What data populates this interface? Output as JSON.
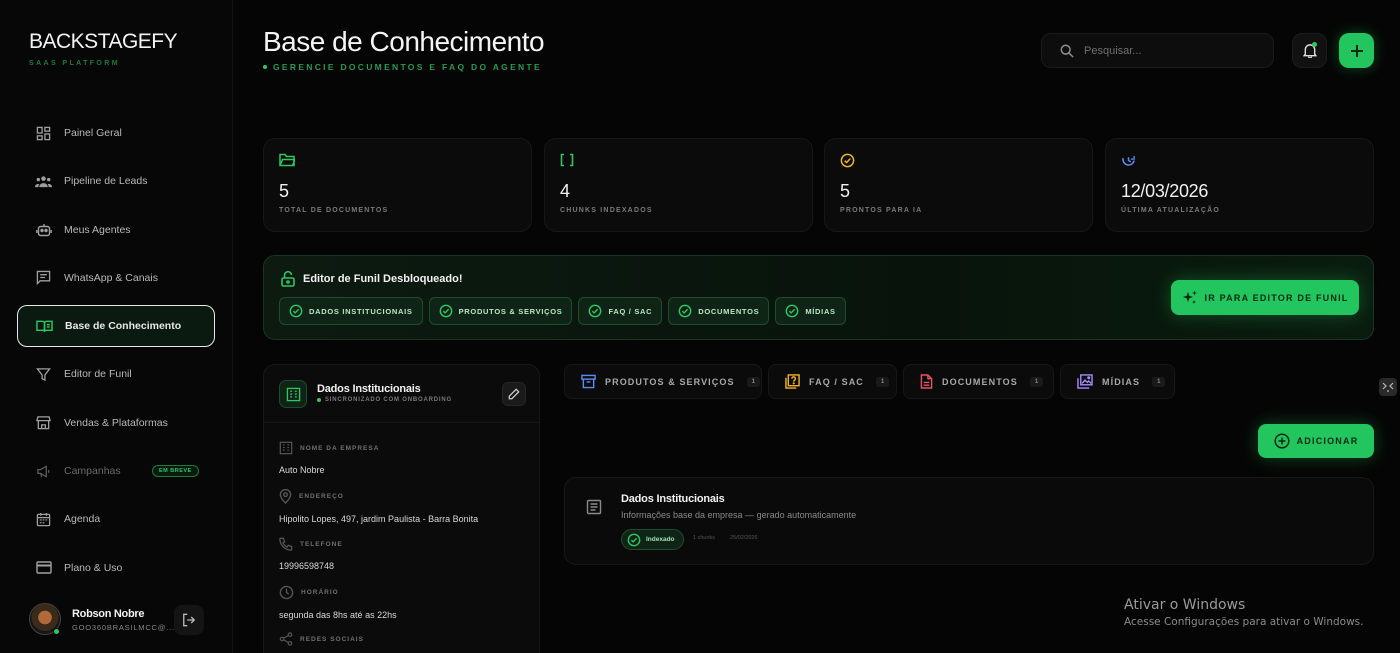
{
  "brand": {
    "name": "BACKSTAGEFY",
    "tagline": "SAAS PLATFORM"
  },
  "sidebar": {
    "items": [
      {
        "label": "Painel Geral",
        "icon": "dashboard-icon"
      },
      {
        "label": "Pipeline de Leads",
        "icon": "users-icon"
      },
      {
        "label": "Meus Agentes",
        "icon": "robot-icon"
      },
      {
        "label": "WhatsApp & Canais",
        "icon": "chat-icon"
      },
      {
        "label": "Base de Conhecimento",
        "icon": "book-icon",
        "active": true
      },
      {
        "label": "Editor de Funil",
        "icon": "funnel-icon"
      },
      {
        "label": "Vendas & Plataformas",
        "icon": "store-icon"
      },
      {
        "label": "Campanhas",
        "icon": "megaphone-icon",
        "badge": "EM BREVE",
        "disabled": true
      },
      {
        "label": "Agenda",
        "icon": "calendar-icon"
      },
      {
        "label": "Plano & Uso",
        "icon": "credit-card-icon"
      }
    ]
  },
  "user": {
    "name": "Robson Nobre",
    "email": "GOO360BRASILMCC@..."
  },
  "header": {
    "title": "Base de Conhecimento",
    "subtitle": "GERENCIE DOCUMENTOS E FAQ DO AGENTE",
    "search_placeholder": "Pesquisar..."
  },
  "stats": [
    {
      "value": "5",
      "label": "TOTAL DE DOCUMENTOS",
      "icon": "folder-icon",
      "color": "#2fc763"
    },
    {
      "value": "4",
      "label": "CHUNKS INDEXADOS",
      "icon": "brackets-icon",
      "color": "#2fc763"
    },
    {
      "value": "5",
      "label": "PRONTOS PARA IA",
      "icon": "check-circle-icon",
      "color": "#f0b429"
    },
    {
      "value": "12/03/2026",
      "label": "ÚLTIMA ATUALIZAÇÃO",
      "icon": "refresh-clock-icon",
      "color": "#5b8def"
    }
  ],
  "unlock": {
    "title": "Editor de Funil Desbloqueado!",
    "chips": [
      "DADOS INSTITUCIONAIS",
      "PRODUTOS & SERVIÇOS",
      "FAQ / SAC",
      "DOCUMENTOS",
      "MÍDIAS"
    ],
    "button": "IR PARA EDITOR DE FUNIL"
  },
  "info_card": {
    "title": "Dados Institucionais",
    "sync": "SINCRONIZADO COM ONBOARDING",
    "fields": [
      {
        "label": "NOME DA EMPRESA",
        "value": "Auto Nobre",
        "icon": "building-icon"
      },
      {
        "label": "ENDEREÇO",
        "value": "Hipolito Lopes, 497, jardim Paulista - Barra Bonita",
        "icon": "location-icon"
      },
      {
        "label": "TELEFONE",
        "value": "19996598748",
        "icon": "phone-icon"
      },
      {
        "label": "HORÁRIO",
        "value": "segunda das 8hs até as 22hs",
        "icon": "clock-icon"
      },
      {
        "label": "REDES SOCIAIS",
        "value": "",
        "icon": "share-icon"
      }
    ]
  },
  "tabs": [
    {
      "label": "PRODUTOS & SERVIÇOS",
      "count": "1",
      "icon": "box-icon",
      "color": "#5b8def"
    },
    {
      "label": "FAQ / SAC",
      "count": "1",
      "icon": "faq-icon",
      "color": "#f0b429"
    },
    {
      "label": "DOCUMENTOS",
      "count": "1",
      "icon": "document-icon",
      "color": "#e25563"
    },
    {
      "label": "MÍDIAS",
      "count": "1",
      "icon": "media-icon",
      "color": "#a78bfa"
    }
  ],
  "add_button": "ADICIONAR",
  "document": {
    "title": "Dados Institucionais",
    "description": "Informações base da empresa — gerado automaticamente",
    "status": "Indexado",
    "chunks": "1 chunks",
    "date": "25/02/2026"
  },
  "watermark": {
    "title": "Ativar o Windows",
    "subtitle": "Acesse Configurações para ativar o Windows."
  }
}
